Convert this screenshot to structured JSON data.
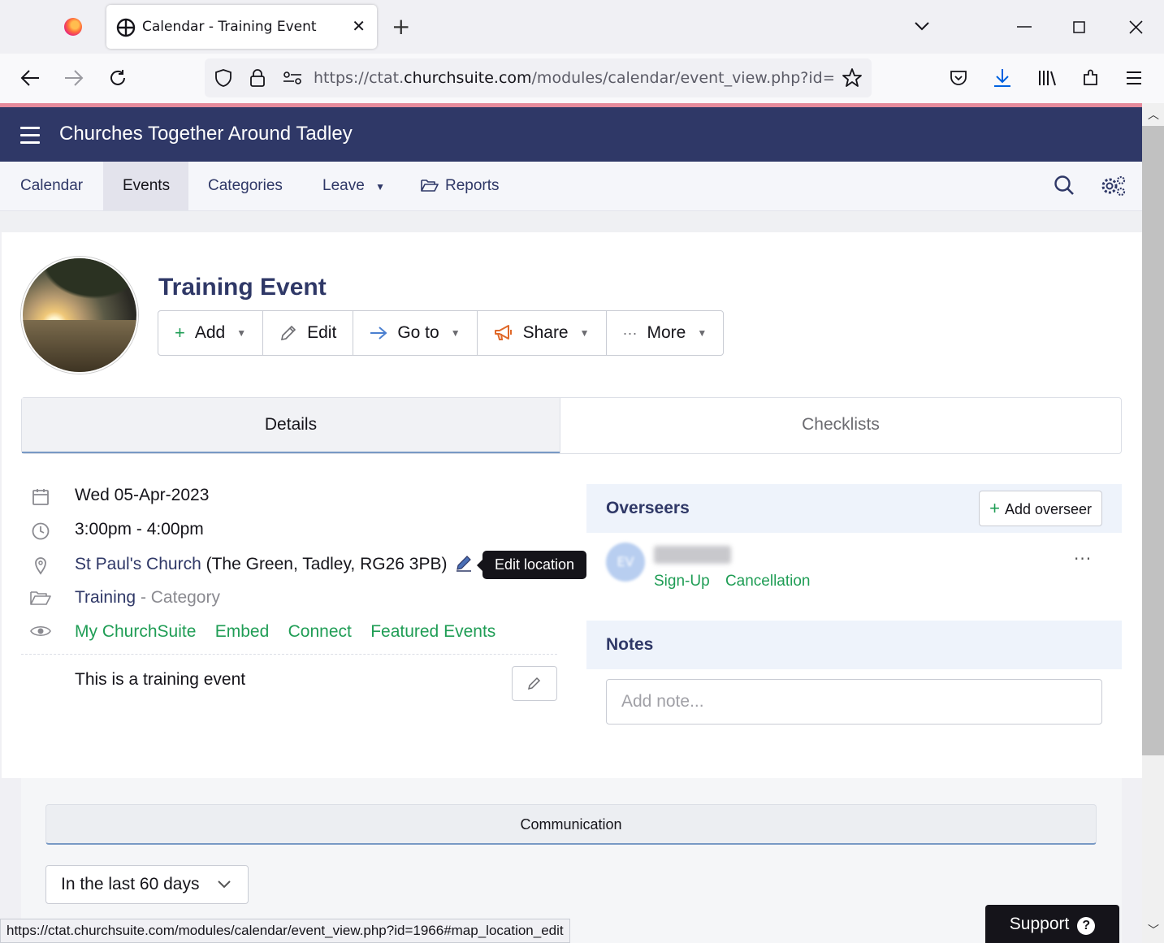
{
  "browser": {
    "tab_title": "Calendar - Training Event",
    "tab_close": "✕",
    "new_tab": "+",
    "url_prefix": "https://ctat.",
    "url_host": "churchsuite.com",
    "url_path": "/modules/calendar/event_view.php?id=19",
    "status_url": "https://ctat.churchsuite.com/modules/calendar/event_view.php?id=1966#map_location_edit"
  },
  "app": {
    "org_name": "Churches Together Around Tadley",
    "nav": {
      "calendar": "Calendar",
      "events": "Events",
      "categories": "Categories",
      "leave": "Leave",
      "reports": "Reports"
    }
  },
  "event": {
    "title": "Training Event",
    "actions": {
      "add": "Add",
      "edit": "Edit",
      "goto": "Go to",
      "share": "Share",
      "more": "More"
    },
    "tabs": {
      "details": "Details",
      "checklists": "Checklists"
    },
    "date": "Wed 05-Apr-2023",
    "time": "3:00pm - 4:00pm",
    "location_name": "St Paul's Church",
    "location_address": "(The Green, Tadley, RG26 3PB)",
    "edit_location_tooltip": "Edit location",
    "category_name": "Training",
    "category_suffix": "- Category",
    "visibility": [
      "My ChurchSuite",
      "Embed",
      "Connect",
      "Featured Events"
    ],
    "description": "This is a training event"
  },
  "overseers": {
    "title": "Overseers",
    "add_label": "Add overseer",
    "avatar_initials": "EV",
    "links": [
      "Sign-Up",
      "Cancellation"
    ]
  },
  "notes": {
    "title": "Notes",
    "placeholder": "Add note..."
  },
  "communication": {
    "title": "Communication",
    "range": "In the last 60 days"
  },
  "support": {
    "label": "Support"
  },
  "colors": {
    "header": "#2f3867",
    "accent_green": "#1f9d55",
    "tab_underline": "#7899c5"
  }
}
